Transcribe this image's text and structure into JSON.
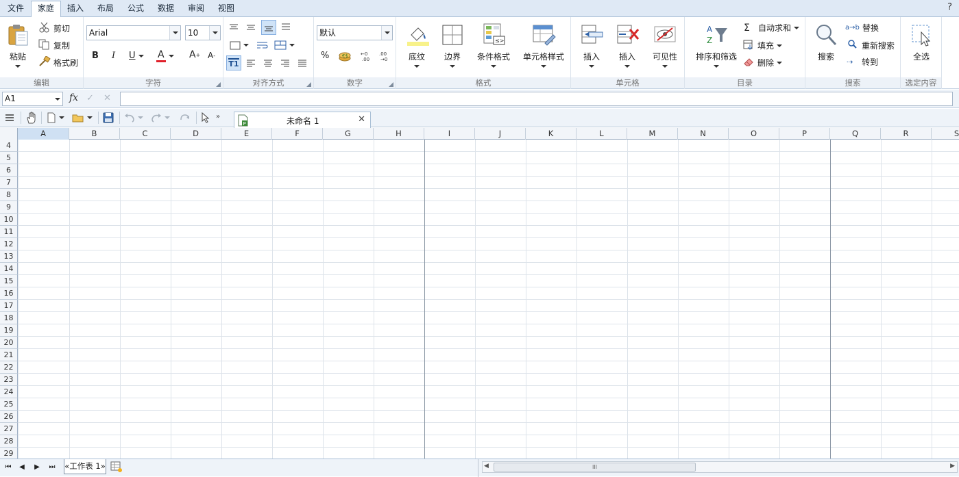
{
  "menu": {
    "tabs": [
      "文件",
      "家庭",
      "插入",
      "布局",
      "公式",
      "数据",
      "审阅",
      "视图"
    ],
    "active": "家庭",
    "help": "?"
  },
  "ribbon": {
    "edit": {
      "label": "编辑",
      "paste": "粘贴",
      "cut": "剪切",
      "copy": "复制",
      "format_painter": "格式刷"
    },
    "font": {
      "label": "字符",
      "family": "Arial",
      "size": "10",
      "bold": "B",
      "italic": "I",
      "underline": "U",
      "font_color": "A",
      "grow": "A",
      "shrink": "A"
    },
    "align": {
      "label": "对齐方式"
    },
    "number": {
      "label": "数字",
      "format": "默认",
      "percent": "%"
    },
    "format": {
      "label": "格式",
      "fill": "底纹",
      "border": "边界",
      "conditional": "条件格式",
      "cell_style": "单元格样式"
    },
    "cells": {
      "label": "单元格",
      "insert": "插入",
      "delete": "插入",
      "visibility": "可见性"
    },
    "catalog": {
      "label": "目录",
      "sort_filter": "排序和筛选",
      "autosum": "自动求和",
      "fill": "填充",
      "delete": "删除"
    },
    "search": {
      "label": "搜索",
      "search": "搜索",
      "replace": "替换",
      "research": "重新搜索",
      "goto": "转到"
    },
    "select": {
      "label": "选定内容",
      "select_all": "全选"
    }
  },
  "formula_bar": {
    "cell_ref": "A1",
    "fx": "fx",
    "confirm": "✓",
    "cancel": "✕",
    "value": ""
  },
  "document": {
    "title": "未命名 1",
    "close": "✕"
  },
  "sheet": {
    "columns": [
      "A",
      "B",
      "C",
      "D",
      "E",
      "F",
      "G",
      "H",
      "I",
      "J",
      "K",
      "L",
      "M",
      "N",
      "O",
      "P",
      "Q",
      "R",
      "S"
    ],
    "selected_column": "A",
    "rows": [
      "4",
      "5",
      "6",
      "7",
      "8",
      "9",
      "10",
      "11",
      "12",
      "13",
      "14",
      "15",
      "16",
      "17",
      "18",
      "19",
      "20",
      "21",
      "22",
      "23",
      "24",
      "25",
      "26",
      "27",
      "28",
      "29"
    ]
  },
  "bottom": {
    "sheet_tab": "«工作表 1»",
    "scroll_grip": "III"
  }
}
